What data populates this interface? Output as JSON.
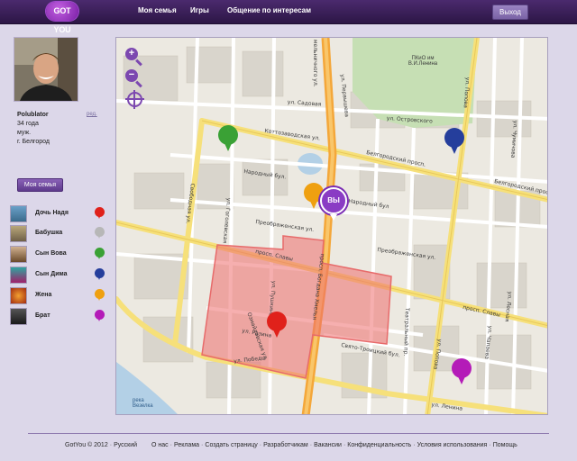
{
  "header": {
    "logo": "GOT YOU",
    "nav": [
      "Моя семья",
      "Игры",
      "Общение по интересам"
    ],
    "logout": "Выход"
  },
  "profile": {
    "name": "Polublator",
    "edit": "ред.",
    "age": "34 года",
    "gender": "муж.",
    "city": "г. Белгород"
  },
  "family_button": "Моя семья",
  "members": [
    {
      "name": "Дочь Надя",
      "color": "#e0211b"
    },
    {
      "name": "Бабушка",
      "color": "#b7b7b7"
    },
    {
      "name": "Сын Вова",
      "color": "#3aa135"
    },
    {
      "name": "Сын Дима",
      "color": "#253e9c"
    },
    {
      "name": "Жена",
      "color": "#efa010"
    },
    {
      "name": "Брат",
      "color": "#b41bb8"
    }
  ],
  "map": {
    "you_label": "ВЫ",
    "zoom_in": "+",
    "zoom_out": "−",
    "streets": [
      "мельничного ул.",
      "Коттозаводская ул.",
      "Белгородский просп.",
      "Белгородский просп.",
      "Народный бул.",
      "Народный бул",
      "Преображенская ул.",
      "Преображенская ул.",
      "просп. Славы",
      "просп. Славы",
      "ул. Островского",
      "ул. Попова",
      "ул. Попова",
      "Свободная ул.",
      "ул. Гоголевская",
      "ул. Пушкина",
      "ул. Разина",
      "ул. Победы",
      "просп. Богдана Хмельн",
      "Свято-Троицкий бул.",
      "Театральный пр.",
      "ул. Чапаева",
      "ул. Чумичова",
      "Озмайловская ул.",
      "ул. Лесная",
      "ул. Садовая",
      "ул. Первышева",
      "ул. Ленина"
    ],
    "park_label": "ПКиО им\nВ.И.Ленина",
    "river_label": "река\nВезелка"
  },
  "footer": {
    "copyright": "GotYou © 2012",
    "lang": "Русский",
    "links": [
      "О нас",
      "Реклама",
      "Создать страницу",
      "Разработчикам",
      "Вакансии",
      "Конфиденциальность",
      "Условия использования",
      "Помощь"
    ]
  }
}
